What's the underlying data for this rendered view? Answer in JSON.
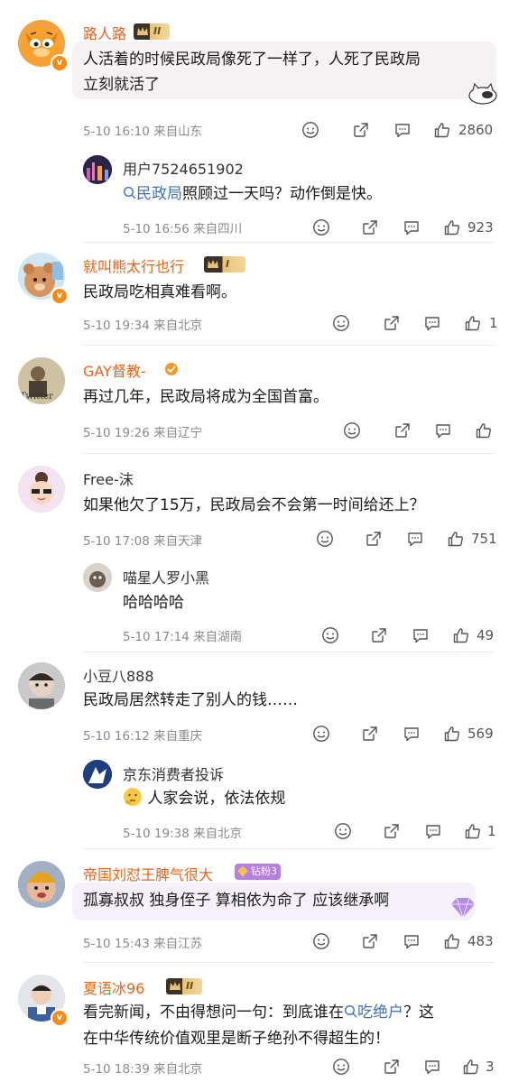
{
  "comments": [
    {
      "username": "路人路",
      "badge_level": "II",
      "text_lines": [
        "人活着的时候民政局像死了一样了，人死了民政局",
        "立刻就活了"
      ],
      "meta": "5-10 16:10  来自山东",
      "likes": "2860",
      "replies": [
        {
          "username": "用户7524651902",
          "link_text": "民政局",
          "text": "照顾过一天吗？动作倒是快。",
          "meta": "5-10 16:56  来自四川",
          "likes": "923"
        }
      ]
    },
    {
      "username": "就叫熊太行也行",
      "badge_level": "I",
      "text_lines": [
        "民政局吃相真难看啊。"
      ],
      "meta": "5-10 19:34  来自北京",
      "likes": "1"
    },
    {
      "username": "GAY督教-",
      "text_lines": [
        "再过几年，民政局将成为全国首富。"
      ],
      "meta": "5-10 19:26  来自辽宁",
      "likes": ""
    },
    {
      "username": "Free-沫",
      "text_lines": [
        "如果他欠了15万，民政局会不会第一时间给还上？"
      ],
      "meta": "5-10 17:08  来自天津",
      "likes": "751",
      "replies": [
        {
          "username": "喵星人罗小黑",
          "text": "哈哈哈哈",
          "meta": "5-10 17:14  来自湖南",
          "likes": "49"
        }
      ]
    },
    {
      "username": "小豆八888",
      "text_lines": [
        "民政局居然转走了别人的钱……"
      ],
      "meta": "5-10 16:12  来自重庆",
      "likes": "569",
      "replies": [
        {
          "username": "京东消费者投诉",
          "text": "人家会说，依法依规",
          "meta": "5-10 19:38  来自北京",
          "likes": "1"
        }
      ]
    },
    {
      "username": "帝国刘怼王脾气很大",
      "fan_badge": "钻粉3",
      "text_lines": [
        "孤寡叔叔 独身侄子 算相依为命了 应该继承啊"
      ],
      "meta": "5-10 15:43  来自江苏",
      "likes": "483"
    },
    {
      "username": "夏语冰96",
      "badge_level": "II",
      "text_line1_pre": "看完新闻，不由得想问一句：到底谁在",
      "text_line1_link": "吃绝户",
      "text_line1_post": "？这",
      "text_line2": "在中华传统价值观里是断子绝孙不得超生的！",
      "meta": "5-10 18:39  来自北京",
      "likes": "3"
    }
  ],
  "colors": {
    "orange_name": "#e5651a",
    "link": "#3e70b8",
    "meta": "#8a8a8a"
  }
}
